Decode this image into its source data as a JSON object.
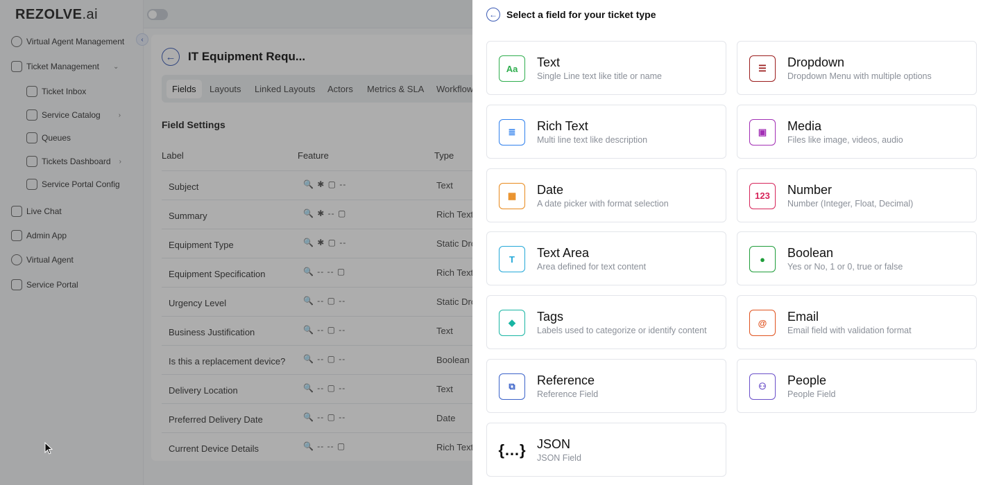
{
  "logo": {
    "main": "REZOLVE",
    "suffix": ".ai"
  },
  "sidebar": {
    "items": [
      {
        "label": "Virtual Agent Management"
      },
      {
        "label": "Ticket Management"
      },
      {
        "label": "Ticket Inbox"
      },
      {
        "label": "Service Catalog"
      },
      {
        "label": "Queues"
      },
      {
        "label": "Tickets Dashboard"
      },
      {
        "label": "Service Portal Config"
      },
      {
        "label": "Live Chat"
      },
      {
        "label": "Admin App"
      },
      {
        "label": "Virtual Agent"
      },
      {
        "label": "Service Portal"
      }
    ]
  },
  "main": {
    "title": "IT Equipment Requ...",
    "tabs": [
      "Fields",
      "Layouts",
      "Linked Layouts",
      "Actors",
      "Metrics & SLA",
      "Workflow"
    ],
    "section_title": "Field Settings",
    "columns": [
      "Label",
      "Feature",
      "Type"
    ],
    "rows": [
      {
        "label": "Subject",
        "feature": "🔍 ✱ ▢ --",
        "type": "Text"
      },
      {
        "label": "Summary",
        "feature": "🔍 ✱ -- ▢",
        "type": "Rich Text"
      },
      {
        "label": "Equipment Type",
        "feature": "🔍 ✱ ▢ --",
        "type": "Static Dro"
      },
      {
        "label": "Equipment Specification",
        "feature": "🔍 -- -- ▢",
        "type": "Rich Text"
      },
      {
        "label": "Urgency Level",
        "feature": "🔍 -- ▢ --",
        "type": "Static Dro"
      },
      {
        "label": "Business Justification",
        "feature": "🔍 -- ▢ --",
        "type": "Text"
      },
      {
        "label": "Is this a replacement device?",
        "feature": "🔍 -- ▢ --",
        "type": "Boolean"
      },
      {
        "label": "Delivery Location",
        "feature": "🔍 -- ▢ --",
        "type": "Text"
      },
      {
        "label": "Preferred Delivery Date",
        "feature": "🔍 -- ▢ --",
        "type": "Date"
      },
      {
        "label": "Current Device Details",
        "feature": "🔍 -- -- ▢",
        "type": "Rich Text"
      }
    ]
  },
  "panel": {
    "title": "Select a field for your ticket type",
    "fields": [
      {
        "name": "Text",
        "desc": "Single Line text like title or name",
        "icon": "text-aa-icon",
        "glyph": "Aa",
        "color": "#2fae4e"
      },
      {
        "name": "Dropdown",
        "desc": "Dropdown Menu with multiple options",
        "icon": "dropdown-list-icon",
        "glyph": "☰",
        "color": "#9b1c1c"
      },
      {
        "name": "Rich Text",
        "desc": "Multi line text like description",
        "icon": "rich-text-icon",
        "glyph": "≣",
        "color": "#2f80ed"
      },
      {
        "name": "Media",
        "desc": "Files like image, videos, audio",
        "icon": "media-image-icon",
        "glyph": "▣",
        "color": "#a22fb5"
      },
      {
        "name": "Date",
        "desc": "A date picker with format selection",
        "icon": "calendar-icon",
        "glyph": "▦",
        "color": "#e8891b"
      },
      {
        "name": "Number",
        "desc": "Number (Integer, Float, Decimal)",
        "icon": "number-123-icon",
        "glyph": "123",
        "color": "#d6245a"
      },
      {
        "name": "Text Area",
        "desc": "Area defined for text content",
        "icon": "text-area-icon",
        "glyph": "T",
        "color": "#23a8d8"
      },
      {
        "name": "Boolean",
        "desc": "Yes or No, 1 or 0, true or false",
        "icon": "toggle-icon",
        "glyph": "●",
        "color": "#1f9d3a"
      },
      {
        "name": "Tags",
        "desc": "Labels used to categorize or identify content",
        "icon": "tag-icon",
        "glyph": "◆",
        "color": "#18b5a3"
      },
      {
        "name": "Email",
        "desc": "Email field with validation format",
        "icon": "at-sign-icon",
        "glyph": "@",
        "color": "#e0521e"
      },
      {
        "name": "Reference",
        "desc": "Reference Field",
        "icon": "reference-icon",
        "glyph": "⧉",
        "color": "#3a62c9"
      },
      {
        "name": "People",
        "desc": "People Field",
        "icon": "people-icon",
        "glyph": "⚇",
        "color": "#6a4fc9"
      },
      {
        "name": "JSON",
        "desc": "JSON Field",
        "icon": "json-braces-icon",
        "glyph": "{…}",
        "color": "#111111"
      }
    ]
  }
}
